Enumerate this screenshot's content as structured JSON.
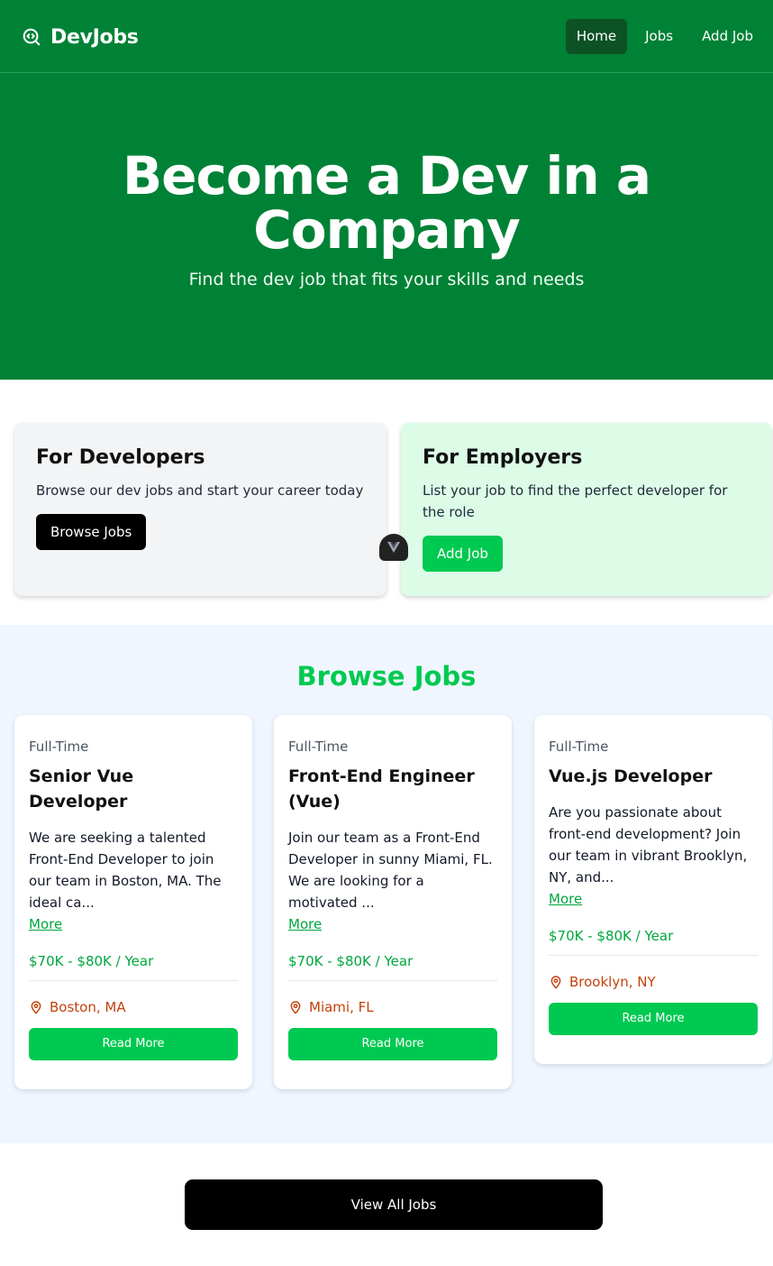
{
  "navbar": {
    "brand": "DevJobs",
    "links": [
      "Home",
      "Jobs",
      "Add Job"
    ],
    "active": "Home",
    "brand_icon": "search-code-icon"
  },
  "hero": {
    "title": "Become a Dev in a Company",
    "subtitle": "Find the dev job that fits your skills and needs"
  },
  "cards": {
    "developers": {
      "title": "For Developers",
      "text": "Browse our dev jobs and start your career today",
      "button": "Browse Jobs"
    },
    "employers": {
      "title": "For Employers",
      "text": "List your job to find the perfect developer for the role",
      "button": "Add Job"
    }
  },
  "browse": {
    "title": "Browse Jobs",
    "jobs": [
      {
        "type": "Full-Time",
        "title": "Senior Vue Developer",
        "description": "We are seeking a talented Front-End Developer to join our team in Boston, MA. The ideal ca...",
        "more": "More",
        "salary": "$70K - $80K / Year",
        "location": "Boston, MA",
        "button": "Read More"
      },
      {
        "type": "Full-Time",
        "title": "Front-End Engineer (Vue)",
        "description": "Join our team as a Front-End Developer in sunny Miami, FL. We are looking for a motivated ...",
        "more": "More",
        "salary": "$70K - $80K / Year",
        "location": "Miami, FL",
        "button": "Read More"
      },
      {
        "type": "Full-Time",
        "title": "Vue.js Developer",
        "description": "Are you passionate about front-end development? Join our team in vibrant Brooklyn, NY, and...",
        "more": "More",
        "salary": "$70K - $80K / Year",
        "location": "Brooklyn, NY",
        "button": "Read More"
      }
    ]
  },
  "view_all": "View All Jobs",
  "colors": {
    "header_green": "#008236",
    "accent_green": "#00c951",
    "location_orange": "#c2410c"
  }
}
